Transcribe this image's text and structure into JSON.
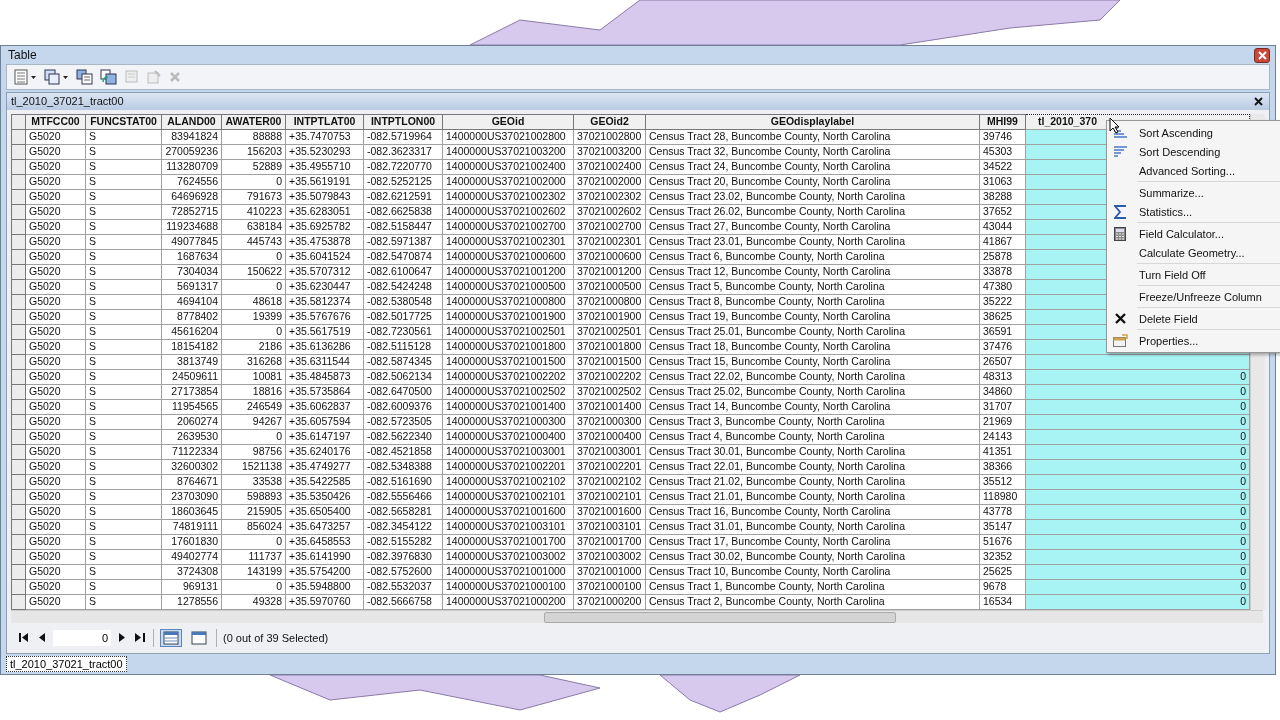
{
  "window": {
    "title": "Table"
  },
  "table_tab": {
    "title": "tl_2010_37021_tract00"
  },
  "table": {
    "columns": [
      {
        "label": "MTFCC00",
        "selected": false
      },
      {
        "label": "FUNCSTAT00",
        "selected": false
      },
      {
        "label": "ALAND00",
        "selected": false
      },
      {
        "label": "AWATER00",
        "selected": false
      },
      {
        "label": "INTPTLAT00",
        "selected": false
      },
      {
        "label": "INTPTLON00",
        "selected": false
      },
      {
        "label": "GEOid",
        "selected": false
      },
      {
        "label": "GEOid2",
        "selected": false
      },
      {
        "label": "GEOdisplaylabel",
        "selected": false
      },
      {
        "label": "MHI99",
        "selected": false
      },
      {
        "label": "tl_2010_370",
        "selected": true
      }
    ],
    "rows": [
      [
        "G5020",
        "S",
        "83941824",
        "88888",
        "+35.7470753",
        "-082.5719964",
        "1400000US37021002800",
        "37021002800",
        "Census Tract 28, Buncombe County, North Carolina",
        "39746"
      ],
      [
        "G5020",
        "S",
        "270059236",
        "156203",
        "+35.5230293",
        "-082.3623317",
        "1400000US37021003200",
        "37021003200",
        "Census Tract 32, Buncombe County, North Carolina",
        "45303"
      ],
      [
        "G5020",
        "S",
        "113280709",
        "52889",
        "+35.4955710",
        "-082.7220770",
        "1400000US37021002400",
        "37021002400",
        "Census Tract 24, Buncombe County, North Carolina",
        "34522"
      ],
      [
        "G5020",
        "S",
        "7624556",
        "0",
        "+35.5619191",
        "-082.5252125",
        "1400000US37021002000",
        "37021002000",
        "Census Tract 20, Buncombe County, North Carolina",
        "31063"
      ],
      [
        "G5020",
        "S",
        "64696928",
        "791673",
        "+35.5079843",
        "-082.6212591",
        "1400000US37021002302",
        "37021002302",
        "Census Tract 23.02, Buncombe County, North Carolina",
        "38288"
      ],
      [
        "G5020",
        "S",
        "72852715",
        "410223",
        "+35.6283051",
        "-082.6625838",
        "1400000US37021002602",
        "37021002602",
        "Census Tract 26.02, Buncombe County, North Carolina",
        "37652"
      ],
      [
        "G5020",
        "S",
        "119234688",
        "638184",
        "+35.6925782",
        "-082.5158447",
        "1400000US37021002700",
        "37021002700",
        "Census Tract 27, Buncombe County, North Carolina",
        "43044"
      ],
      [
        "G5020",
        "S",
        "49077845",
        "445743",
        "+35.4753878",
        "-082.5971387",
        "1400000US37021002301",
        "37021002301",
        "Census Tract 23.01, Buncombe County, North Carolina",
        "41867"
      ],
      [
        "G5020",
        "S",
        "1687634",
        "0",
        "+35.6041524",
        "-082.5470874",
        "1400000US37021000600",
        "37021000600",
        "Census Tract 6, Buncombe County, North Carolina",
        "25878"
      ],
      [
        "G5020",
        "S",
        "7304034",
        "150622",
        "+35.5707312",
        "-082.6100647",
        "1400000US37021001200",
        "37021001200",
        "Census Tract 12, Buncombe County, North Carolina",
        "33878"
      ],
      [
        "G5020",
        "S",
        "5691317",
        "0",
        "+35.6230447",
        "-082.5424248",
        "1400000US37021000500",
        "37021000500",
        "Census Tract 5, Buncombe County, North Carolina",
        "47380"
      ],
      [
        "G5020",
        "S",
        "4694104",
        "48618",
        "+35.5812374",
        "-082.5380548",
        "1400000US37021000800",
        "37021000800",
        "Census Tract 8, Buncombe County, North Carolina",
        "35222"
      ],
      [
        "G5020",
        "S",
        "8778402",
        "19399",
        "+35.5767676",
        "-082.5017725",
        "1400000US37021001900",
        "37021001900",
        "Census Tract 19, Buncombe County, North Carolina",
        "38625"
      ],
      [
        "G5020",
        "S",
        "45616204",
        "0",
        "+35.5617519",
        "-082.7230561",
        "1400000US37021002501",
        "37021002501",
        "Census Tract 25.01, Buncombe County, North Carolina",
        "36591"
      ],
      [
        "G5020",
        "S",
        "18154182",
        "2186",
        "+35.6136286",
        "-082.5115128",
        "1400000US37021001800",
        "37021001800",
        "Census Tract 18, Buncombe County, North Carolina",
        "37476"
      ],
      [
        "G5020",
        "S",
        "3813749",
        "316268",
        "+35.6311544",
        "-082.5874345",
        "1400000US37021001500",
        "37021001500",
        "Census Tract 15, Buncombe County, North Carolina",
        "26507"
      ],
      [
        "G5020",
        "S",
        "24509611",
        "10081",
        "+35.4845873",
        "-082.5062134",
        "1400000US37021002202",
        "37021002202",
        "Census Tract 22.02, Buncombe County, North Carolina",
        "48313",
        "0"
      ],
      [
        "G5020",
        "S",
        "27173854",
        "18816",
        "+35.5735864",
        "-082.6470500",
        "1400000US37021002502",
        "37021002502",
        "Census Tract 25.02, Buncombe County, North Carolina",
        "34860",
        "0"
      ],
      [
        "G5020",
        "S",
        "11954565",
        "246549",
        "+35.6062837",
        "-082.6009376",
        "1400000US37021001400",
        "37021001400",
        "Census Tract 14, Buncombe County, North Carolina",
        "31707",
        "0"
      ],
      [
        "G5020",
        "S",
        "2060274",
        "94267",
        "+35.6057594",
        "-082.5723505",
        "1400000US37021000300",
        "37021000300",
        "Census Tract 3, Buncombe County, North Carolina",
        "21969",
        "0"
      ],
      [
        "G5020",
        "S",
        "2639530",
        "0",
        "+35.6147197",
        "-082.5622340",
        "1400000US37021000400",
        "37021000400",
        "Census Tract 4, Buncombe County, North Carolina",
        "24143",
        "0"
      ],
      [
        "G5020",
        "S",
        "71122334",
        "98756",
        "+35.6240176",
        "-082.4521858",
        "1400000US37021003001",
        "37021003001",
        "Census Tract 30.01, Buncombe County, North Carolina",
        "41351",
        "0"
      ],
      [
        "G5020",
        "S",
        "32600302",
        "1521138",
        "+35.4749277",
        "-082.5348388",
        "1400000US37021002201",
        "37021002201",
        "Census Tract 22.01, Buncombe County, North Carolina",
        "38366",
        "0"
      ],
      [
        "G5020",
        "S",
        "8764671",
        "33538",
        "+35.5422585",
        "-082.5161690",
        "1400000US37021002102",
        "37021002102",
        "Census Tract 21.02, Buncombe County, North Carolina",
        "35512",
        "0"
      ],
      [
        "G5020",
        "S",
        "23703090",
        "598893",
        "+35.5350426",
        "-082.5556466",
        "1400000US37021002101",
        "37021002101",
        "Census Tract 21.01, Buncombe County, North Carolina",
        "118980",
        "0"
      ],
      [
        "G5020",
        "S",
        "18603645",
        "215905",
        "+35.6505400",
        "-082.5658281",
        "1400000US37021001600",
        "37021001600",
        "Census Tract 16, Buncombe County, North Carolina",
        "43778",
        "0"
      ],
      [
        "G5020",
        "S",
        "74819111",
        "856024",
        "+35.6473257",
        "-082.3454122",
        "1400000US37021003101",
        "37021003101",
        "Census Tract 31.01, Buncombe County, North Carolina",
        "35147",
        "0"
      ],
      [
        "G5020",
        "S",
        "17601830",
        "0",
        "+35.6458553",
        "-082.5155282",
        "1400000US37021001700",
        "37021001700",
        "Census Tract 17, Buncombe County, North Carolina",
        "51676",
        "0"
      ],
      [
        "G5020",
        "S",
        "49402774",
        "111737",
        "+35.6141990",
        "-082.3976830",
        "1400000US37021003002",
        "37021003002",
        "Census Tract 30.02, Buncombe County, North Carolina",
        "32352",
        "0"
      ],
      [
        "G5020",
        "S",
        "3724308",
        "143199",
        "+35.5754200",
        "-082.5752600",
        "1400000US37021001000",
        "37021001000",
        "Census Tract 10, Buncombe County, North Carolina",
        "25625",
        "0"
      ],
      [
        "G5020",
        "S",
        "969131",
        "0",
        "+35.5948800",
        "-082.5532037",
        "1400000US37021000100",
        "37021000100",
        "Census Tract 1, Buncombe County, North Carolina",
        "9678",
        "0"
      ],
      [
        "G5020",
        "S",
        "1278556",
        "49328",
        "+35.5970760",
        "-082.5666758",
        "1400000US37021000200",
        "37021000200",
        "Census Tract 2, Buncombe County, North Carolina",
        "16534",
        "0"
      ]
    ]
  },
  "context_menu": {
    "items": [
      {
        "label": "Sort Ascending",
        "separator_before": false
      },
      {
        "label": "Sort Descending",
        "separator_before": false
      },
      {
        "label": "Advanced Sorting...",
        "separator_before": false
      },
      {
        "label": "Summarize...",
        "separator_before": true
      },
      {
        "label": "Statistics...",
        "separator_before": false
      },
      {
        "label": "Field Calculator...",
        "separator_before": true
      },
      {
        "label": "Calculate Geometry...",
        "separator_before": false
      },
      {
        "label": "Turn Field Off",
        "separator_before": true
      },
      {
        "label": "Freeze/Unfreeze Column",
        "separator_before": true
      },
      {
        "label": "Delete Field",
        "separator_before": true
      },
      {
        "label": "Properties...",
        "separator_before": true
      }
    ]
  },
  "navigator": {
    "record": "0",
    "status": "(0 out of 39 Selected)",
    "views": [
      {
        "selected": true
      },
      {
        "selected": false
      }
    ]
  },
  "bottom_tabs": [
    {
      "label": "tl_2010_37021_tract00",
      "selected": true
    }
  ]
}
